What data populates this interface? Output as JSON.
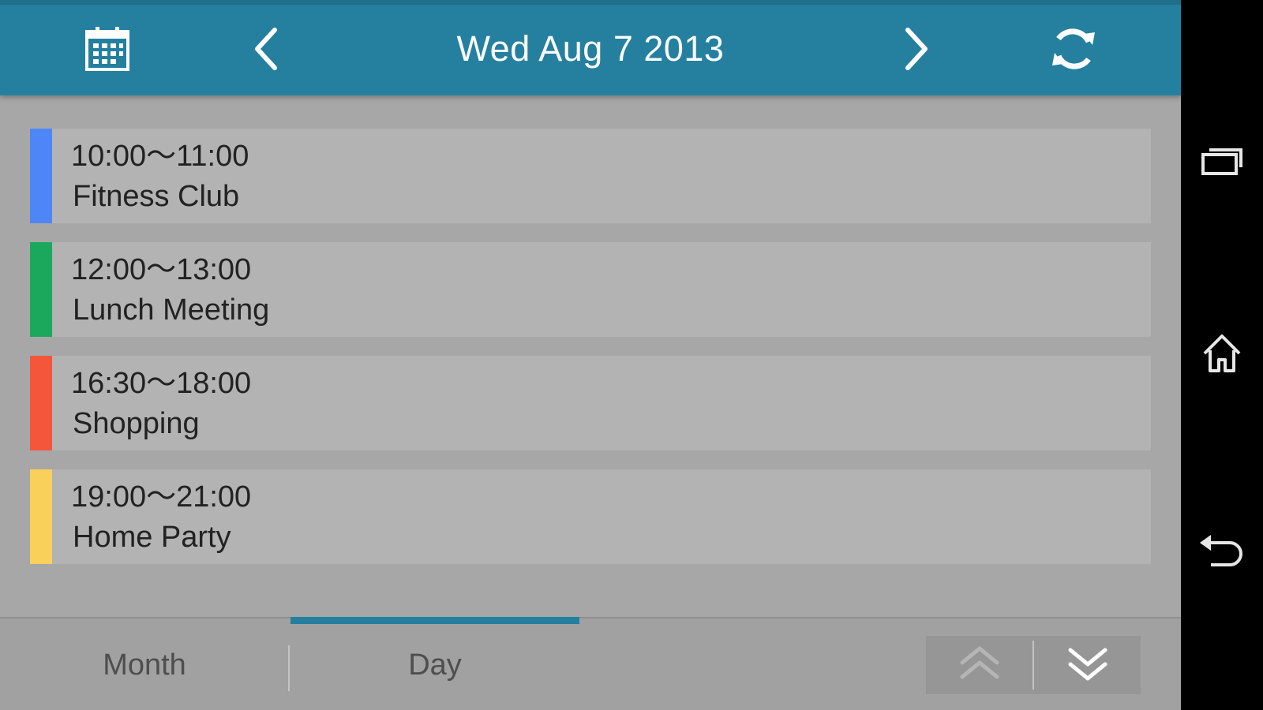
{
  "header": {
    "date_title": "Wed Aug 7 2013",
    "icons": {
      "calendar": "calendar-icon",
      "prev": "chevron-left-icon",
      "next": "chevron-right-icon",
      "refresh": "refresh-icon"
    },
    "background_color": "#25809f"
  },
  "events": [
    {
      "time": "10:00〜11:00",
      "title": "Fitness Club",
      "color": "#4f86f7"
    },
    {
      "time": "12:00〜13:00",
      "title": "Lunch Meeting",
      "color": "#1aa95c"
    },
    {
      "time": "16:30〜18:00",
      "title": "Shopping",
      "color": "#f4563b"
    },
    {
      "time": "19:00〜21:00",
      "title": "Home Party",
      "color": "#f9d15a"
    }
  ],
  "tabs": {
    "month_label": "Month",
    "day_label": "Day",
    "selected": "Day"
  },
  "scroll_controls": {
    "up_icon": "double-chevron-up-icon",
    "down_icon": "double-chevron-down-icon"
  },
  "system_nav": {
    "recent_icon": "recent-apps-icon",
    "home_icon": "home-icon",
    "back_icon": "back-icon"
  }
}
